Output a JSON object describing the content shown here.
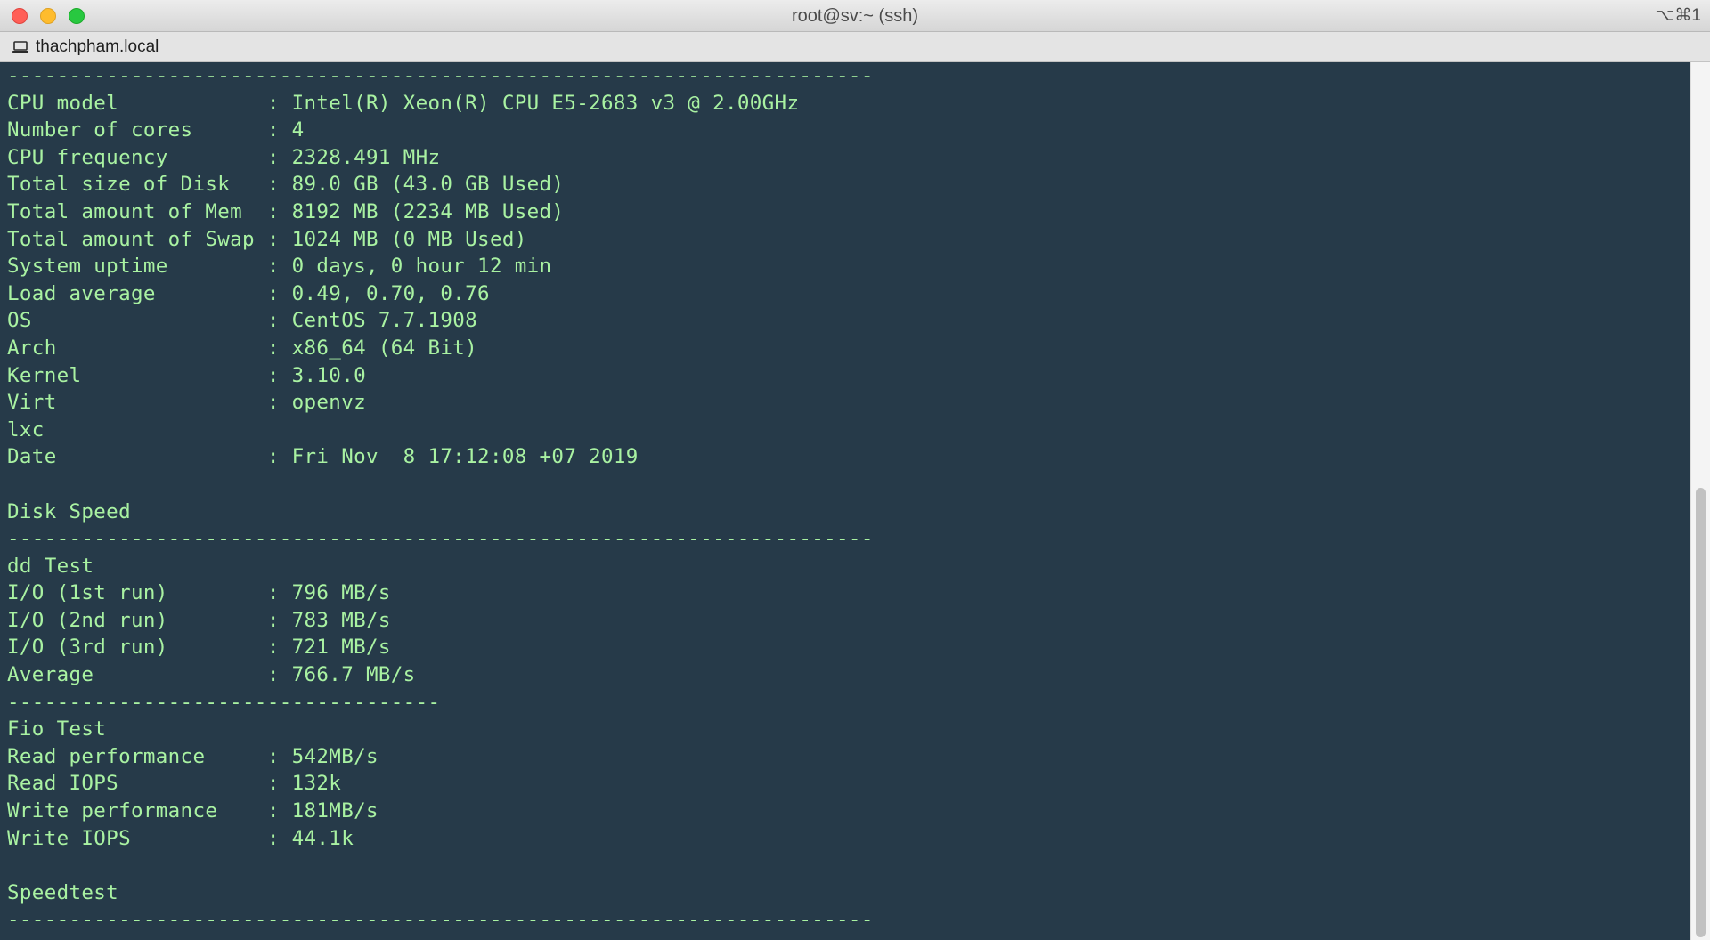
{
  "window": {
    "title": "root@sv:~ (ssh)",
    "shortcut": "⌥⌘1"
  },
  "tab": {
    "label": "thachpham.local",
    "icon": "laptop-icon"
  },
  "colors": {
    "terminal_background": "#263a49",
    "terminal_text": "#a9f2a2"
  },
  "terminal": {
    "lines": [
      "----------------------------------------------------------------------",
      "CPU model            : Intel(R) Xeon(R) CPU E5-2683 v3 @ 2.00GHz",
      "Number of cores      : 4",
      "CPU frequency        : 2328.491 MHz",
      "Total size of Disk   : 89.0 GB (43.0 GB Used)",
      "Total amount of Mem  : 8192 MB (2234 MB Used)",
      "Total amount of Swap : 1024 MB (0 MB Used)",
      "System uptime        : 0 days, 0 hour 12 min",
      "Load average         : 0.49, 0.70, 0.76",
      "OS                   : CentOS 7.7.1908",
      "Arch                 : x86_64 (64 Bit)",
      "Kernel               : 3.10.0",
      "Virt                 : openvz",
      "lxc",
      "Date                 : Fri Nov  8 17:12:08 +07 2019",
      "",
      "Disk Speed",
      "----------------------------------------------------------------------",
      "dd Test",
      "I/O (1st run)        : 796 MB/s",
      "I/O (2nd run)        : 783 MB/s",
      "I/O (3rd run)        : 721 MB/s",
      "Average              : 766.7 MB/s",
      "-----------------------------------",
      "Fio Test",
      "Read performance     : 542MB/s",
      "Read IOPS            : 132k",
      "Write performance    : 181MB/s",
      "Write IOPS           : 44.1k",
      "",
      "Speedtest",
      "----------------------------------------------------------------------"
    ]
  }
}
